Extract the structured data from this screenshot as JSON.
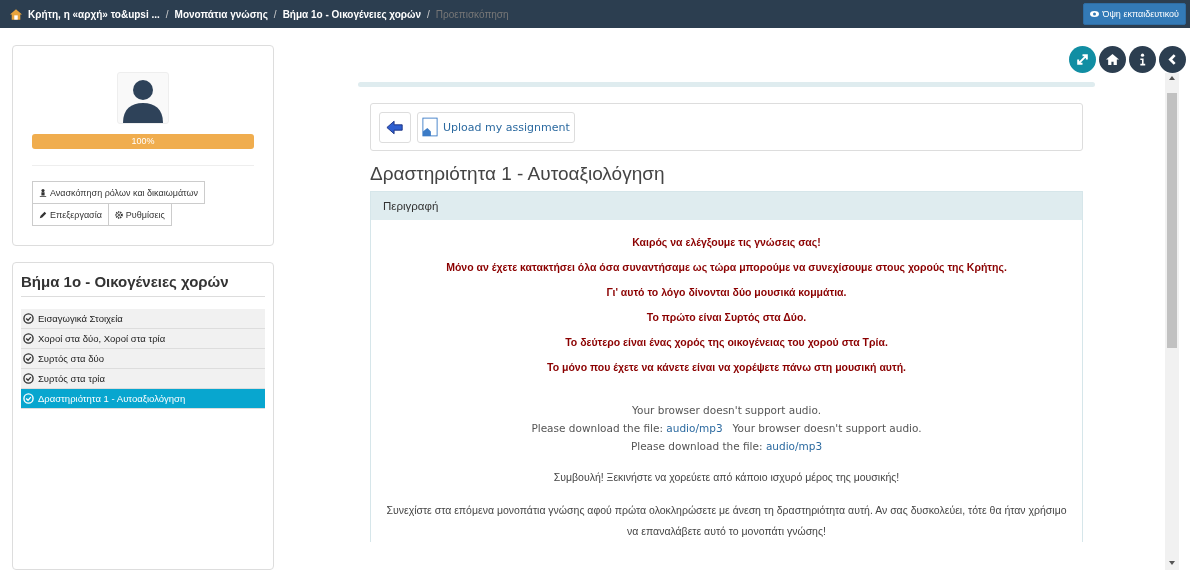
{
  "breadcrumb": [
    {
      "label": "Κρήτη, η «αρχή» το&upsi ...",
      "current": false
    },
    {
      "label": "Μονοπάτια γνώσης",
      "current": false
    },
    {
      "label": "Βήμα 1ο - Οικογένειες χορών",
      "current": false
    },
    {
      "label": "Προεπισκόπηση",
      "current": true
    }
  ],
  "breadcrumb_separator": "/",
  "teacher_view_button": "Όψη εκπαιδευτικού",
  "profile": {
    "progress": {
      "level": 1,
      "label": "100%"
    },
    "buttons": [
      {
        "kind": "roles",
        "label": "Ανασκόπηση ρόλων και δικαιωμάτων"
      },
      {
        "kind": "edit",
        "label": "Επεξεργασία"
      },
      {
        "kind": "settings",
        "label": "Ρυθμίσεις"
      }
    ]
  },
  "sidebar": {
    "title": "Βήμα 1ο - Οικογένειες χορών",
    "items": [
      {
        "label": "Εισαγωγικά Στοιχεία",
        "checked": true,
        "selected": false
      },
      {
        "label": "Χοροί στα δύο, Χοροί στα τρία",
        "checked": true,
        "selected": false
      },
      {
        "label": "Συρτός στα δύο",
        "checked": true,
        "selected": false
      },
      {
        "label": "Συρτός στα τρία",
        "checked": true,
        "selected": false
      },
      {
        "label": "Δραστηριότητα 1 - Αυτοαξιολόγηση",
        "checked": true,
        "selected": true
      }
    ]
  },
  "upload_button": "Upload my assignment",
  "activity": {
    "title": "Δραστηριότητα 1 - Αυτοαξιολόγηση",
    "panel_heading": "Περιγραφή",
    "highlights": [
      "Καιρός να ελέγξουμε τις γνώσεις σας!",
      "Μόνο αν έχετε κατακτήσει όλα όσα συναντήσαμε ως τώρα μπορούμε να συνεχίσουμε στους χορούς της Κρήτης.",
      "Γι' αυτό το λόγο δίνονται δύο μουσικά κομμάτια.",
      "Το πρώτο είναι Συρτός στα Δύο.",
      "Το δεύτερο είναι ένας χορός της οικογένειας του χορού στα Τρία.",
      "Το μόνο που έχετε να κάνετε είναι να χορέψετε πάνω στη μουσική αυτή."
    ],
    "audio": [
      {
        "message": "Your browser doesn't support audio.",
        "download": "Please download the file:",
        "link": "audio/mp3"
      },
      {
        "message": "Your browser doesn't support audio.",
        "download": "Please download the file:",
        "link": "audio/mp3"
      }
    ],
    "tip": "Συμβουλή! Ξεκινήστε να χορεύετε από κάποιο ισχυρό μέρος της μουσικής!",
    "note": "Συνεχίστε στα επόμενα μονοπάτια γνώσης αφού πρώτα ολοκληρώσετε με άνεση τη δραστηριότητα αυτή. Αν σας δυσκολεύει, τότε θα ήταν χρήσιμο να επαναλάβετε αυτό το μονοπάτι γνώσης!"
  }
}
